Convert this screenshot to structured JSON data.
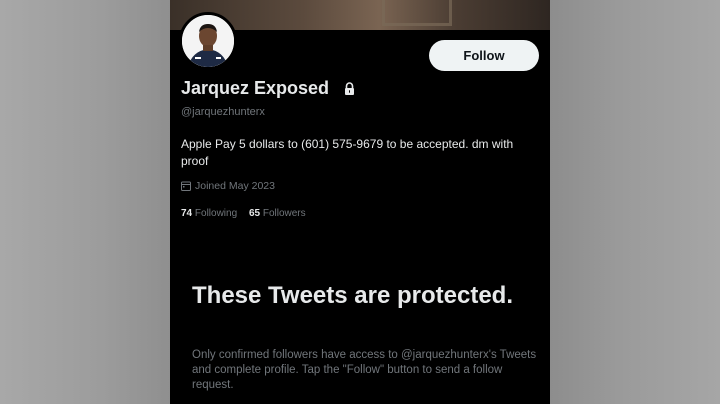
{
  "profile": {
    "display_name": "Jarquez Exposed",
    "handle": "@jarquezhunterx",
    "bio": "Apple Pay 5 dollars to (601) 575-9679 to be accepted. dm with proof",
    "joined": "Joined May 2023",
    "following_count": "74",
    "following_label": "Following",
    "followers_count": "65",
    "followers_label": "Followers",
    "follow_button_label": "Follow",
    "locked": true
  },
  "protected_notice": {
    "title": "These Tweets are protected.",
    "body": "Only confirmed followers have access to @jarquezhunterx's Tweets and complete profile. Tap the \"Follow\" button to send a follow request."
  },
  "icons": {
    "lock": "lock-icon",
    "calendar": "calendar-icon"
  },
  "colors": {
    "background": "#000000",
    "primary_text": "#e7e9ea",
    "secondary_text": "#71767b",
    "follow_button_bg": "#eff3f4"
  }
}
